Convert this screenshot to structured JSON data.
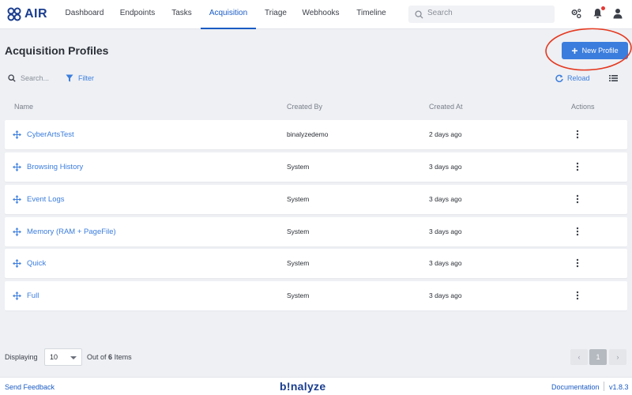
{
  "app": {
    "logo_text": "AIR",
    "brand": "b!nalyze"
  },
  "nav": {
    "tabs": [
      {
        "label": "Dashboard"
      },
      {
        "label": "Endpoints"
      },
      {
        "label": "Tasks"
      },
      {
        "label": "Acquisition"
      },
      {
        "label": "Triage"
      },
      {
        "label": "Webhooks"
      },
      {
        "label": "Timeline"
      }
    ],
    "active_tab": "Acquisition",
    "search_placeholder": "Search"
  },
  "page": {
    "title": "Acquisition Profiles",
    "new_button_label": "New Profile"
  },
  "toolbar": {
    "search_placeholder": "Search...",
    "filter_label": "Filter",
    "reload_label": "Reload"
  },
  "table": {
    "columns": {
      "name": "Name",
      "created_by": "Created By",
      "created_at": "Created At",
      "actions": "Actions"
    },
    "rows": [
      {
        "name": "CyberArtsTest",
        "created_by": "binalyzedemo",
        "created_at": "2 days ago"
      },
      {
        "name": "Browsing History",
        "created_by": "System",
        "created_at": "3 days ago"
      },
      {
        "name": "Event Logs",
        "created_by": "System",
        "created_at": "3 days ago"
      },
      {
        "name": "Memory (RAM + PageFile)",
        "created_by": "System",
        "created_at": "3 days ago"
      },
      {
        "name": "Quick",
        "created_by": "System",
        "created_at": "3 days ago"
      },
      {
        "name": "Full",
        "created_by": "System",
        "created_at": "3 days ago"
      }
    ]
  },
  "pagination": {
    "displaying_label": "Displaying",
    "page_size": "10",
    "out_of_prefix": "Out of",
    "total": "6",
    "items_suffix": "Items",
    "current_page": "1",
    "prev_symbol": "‹",
    "next_symbol": "›"
  },
  "footer": {
    "feedback": "Send Feedback",
    "documentation": "Documentation",
    "version": "v1.8.3"
  },
  "colors": {
    "accent": "#3b7ddd",
    "annotation": "#e53920",
    "notification": "#e53935",
    "logo": "#1a3d8f"
  },
  "icons": [
    "logo-icon",
    "search-icon",
    "settings-icon",
    "bell-icon",
    "user-icon",
    "filter-icon",
    "reload-icon",
    "list-view-icon",
    "drag-handle-icon",
    "more-vertical-icon",
    "plus-icon",
    "caret-down-icon"
  ]
}
